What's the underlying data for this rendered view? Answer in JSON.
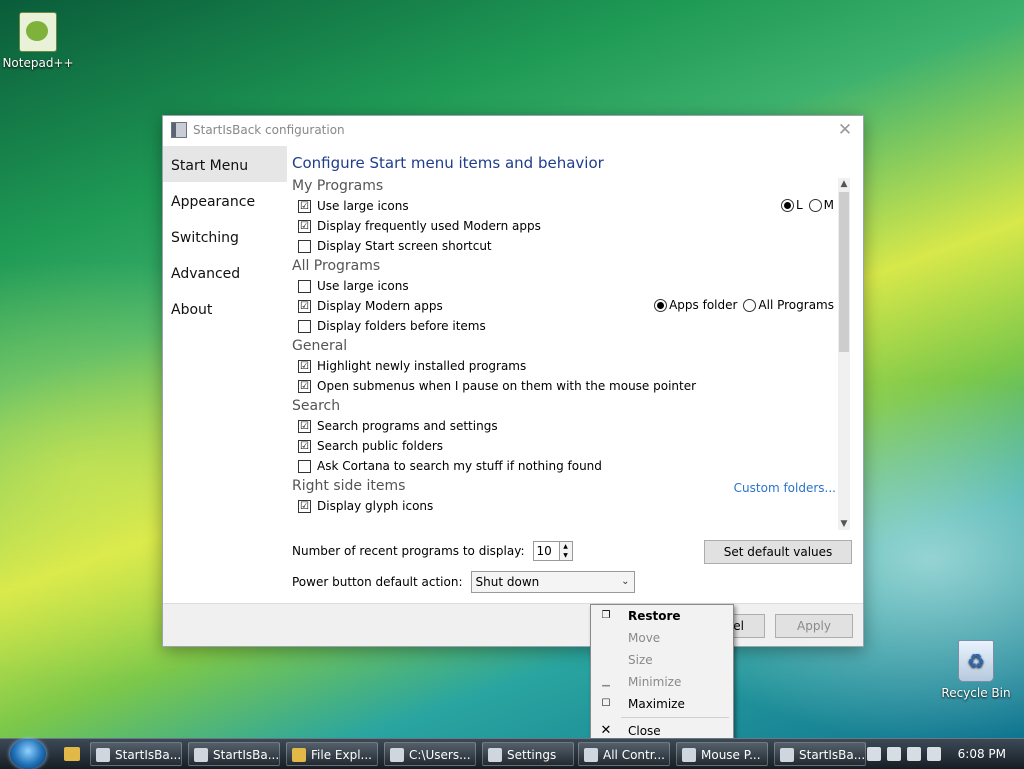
{
  "desktop": {
    "icons": [
      {
        "label": "Notepad++"
      },
      {
        "label": "Recycle Bin"
      }
    ]
  },
  "dialog": {
    "title": "StartIsBack configuration",
    "sidebar": [
      "Start Menu",
      "Appearance",
      "Switching",
      "Advanced",
      "About"
    ],
    "heading": "Configure Start menu items and behavior",
    "sections": {
      "my_programs": {
        "title": "My Programs",
        "options": [
          {
            "label": "Use large icons",
            "checked": "☑"
          },
          {
            "label": "Display frequently used Modern apps",
            "checked": "☑"
          },
          {
            "label": "Display Start screen shortcut",
            "checked": ""
          }
        ],
        "size_radio": {
          "l_label": "L",
          "m_label": "M",
          "selected": "L"
        }
      },
      "all_programs": {
        "title": "All Programs",
        "options": [
          {
            "label": "Use large icons",
            "checked": ""
          },
          {
            "label": "Display Modern apps",
            "checked": "☑"
          },
          {
            "label": "Display folders before items",
            "checked": ""
          }
        ],
        "location_radio": {
          "apps_folder": "Apps folder",
          "all_programs": "All Programs",
          "selected": "Apps folder"
        }
      },
      "general": {
        "title": "General",
        "options": [
          {
            "label": "Highlight newly installed programs",
            "checked": "☑"
          },
          {
            "label": "Open submenus when I pause on them with the mouse pointer",
            "checked": "☑"
          }
        ]
      },
      "search": {
        "title": "Search",
        "options": [
          {
            "label": "Search programs and settings",
            "checked": "☑"
          },
          {
            "label": "Search public folders",
            "checked": "☑"
          },
          {
            "label": "Ask Cortana to search my stuff if nothing found",
            "checked": ""
          }
        ]
      },
      "right_side": {
        "title": "Right side items",
        "link": "Custom folders...",
        "options": [
          {
            "label": "Display glyph icons",
            "checked": "☑"
          }
        ]
      }
    },
    "recent_label": "Number of recent programs to display:",
    "recent_value": "10",
    "default_button": "Set default values",
    "power_label": "Power button default action:",
    "power_value": "Shut down",
    "footer": {
      "cancel_partial": "el",
      "apply": "Apply"
    }
  },
  "context_menu": {
    "items": [
      "Restore",
      "Move",
      "Size",
      "Minimize",
      "Maximize",
      "Close"
    ]
  },
  "taskbar": {
    "items": [
      "StartIsBa...",
      "StartIsBa...",
      "File Expl...",
      "C:\\Users...",
      "Settings",
      "All Contr...",
      "Mouse P...",
      "StartIsBa..."
    ],
    "time": "6:08 PM"
  }
}
